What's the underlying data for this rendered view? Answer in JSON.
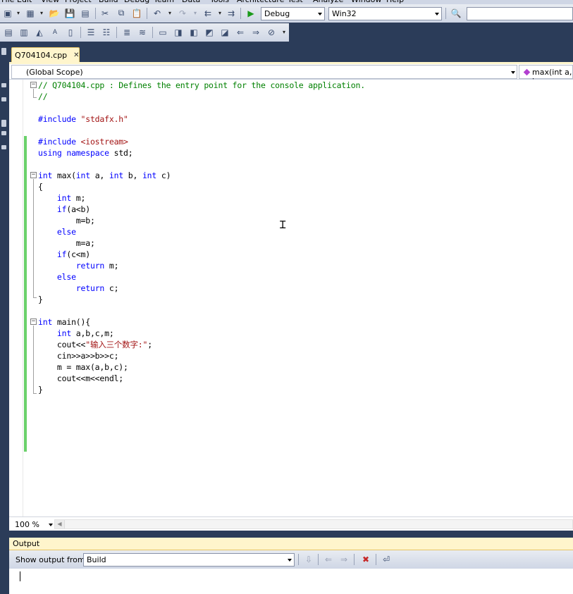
{
  "menu": [
    "File",
    "Edit",
    "View",
    "Project",
    "Build",
    "Debug",
    "Team",
    "Data",
    "Tools",
    "Architecture",
    "Test",
    "Analyze",
    "Window",
    "Help"
  ],
  "toolbar": {
    "configuration": "Debug",
    "platform": "Win32",
    "find_value": ""
  },
  "tab": {
    "title": "Q704104.cpp",
    "close_glyph": "✕"
  },
  "navigation": {
    "scope": "(Global Scope)",
    "member": "max(int a, in"
  },
  "code_lines": [
    [
      {
        "t": "// Q704104.cpp : Defines the entry point for the console application.",
        "c": "cm"
      }
    ],
    [
      {
        "t": "//",
        "c": "cm"
      }
    ],
    [],
    [
      {
        "t": "#include ",
        "c": "kw"
      },
      {
        "t": "\"stdafx.h\"",
        "c": "st"
      }
    ],
    [],
    [
      {
        "t": "#include ",
        "c": "kw"
      },
      {
        "t": "<iostream>",
        "c": "st"
      }
    ],
    [
      {
        "t": "using",
        "c": "kw"
      },
      {
        "t": " "
      },
      {
        "t": "namespace",
        "c": "kw"
      },
      {
        "t": " std;"
      }
    ],
    [],
    [
      {
        "t": "int",
        "c": "kw"
      },
      {
        "t": " max("
      },
      {
        "t": "int",
        "c": "kw"
      },
      {
        "t": " a, "
      },
      {
        "t": "int",
        "c": "kw"
      },
      {
        "t": " b, "
      },
      {
        "t": "int",
        "c": "kw"
      },
      {
        "t": " c)"
      }
    ],
    [
      {
        "t": "{"
      }
    ],
    [
      {
        "t": "    "
      },
      {
        "t": "int",
        "c": "kw"
      },
      {
        "t": " m;"
      }
    ],
    [
      {
        "t": "    "
      },
      {
        "t": "if",
        "c": "kw"
      },
      {
        "t": "(a<b)"
      }
    ],
    [
      {
        "t": "        m=b;"
      }
    ],
    [
      {
        "t": "    "
      },
      {
        "t": "else",
        "c": "kw"
      }
    ],
    [
      {
        "t": "        m=a;"
      }
    ],
    [
      {
        "t": "    "
      },
      {
        "t": "if",
        "c": "kw"
      },
      {
        "t": "(c<m)"
      }
    ],
    [
      {
        "t": "        "
      },
      {
        "t": "return",
        "c": "kw"
      },
      {
        "t": " m;"
      }
    ],
    [
      {
        "t": "    "
      },
      {
        "t": "else",
        "c": "kw"
      }
    ],
    [
      {
        "t": "        "
      },
      {
        "t": "return",
        "c": "kw"
      },
      {
        "t": " c;"
      }
    ],
    [
      {
        "t": "}"
      }
    ],
    [],
    [
      {
        "t": "int",
        "c": "kw"
      },
      {
        "t": " main(){"
      }
    ],
    [
      {
        "t": "    "
      },
      {
        "t": "int",
        "c": "kw"
      },
      {
        "t": " a,b,c,m;"
      }
    ],
    [
      {
        "t": "    cout<<"
      },
      {
        "t": "\"输入三个数字:\"",
        "c": "st"
      },
      {
        "t": ";"
      }
    ],
    [
      {
        "t": "    cin>>a>>b>>c;"
      }
    ],
    [
      {
        "t": "    m = max(a,b,c);"
      }
    ],
    [
      {
        "t": "    cout<<m<<endl;"
      }
    ],
    [
      {
        "t": "}"
      }
    ]
  ],
  "editor": {
    "zoom": "100 %"
  },
  "output": {
    "title": "Output",
    "show_from_label": "Show output from:",
    "source": "Build"
  },
  "colors": {
    "keyword": "#0000ff",
    "comment": "#008000",
    "string": "#a31515",
    "chrome": "#2b3c59",
    "tab_active": "#fff5cc",
    "change_bar": "#6bd16b"
  }
}
